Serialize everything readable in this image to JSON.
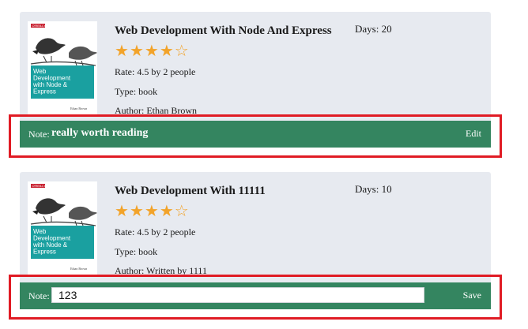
{
  "books": [
    {
      "cover": {
        "publisher": "O'REILLY",
        "title_lines": [
          "Web",
          "Development",
          "with Node &",
          "Express"
        ],
        "author": "Ethan Brown"
      },
      "title": "Web Development With Node And Express",
      "days": "Days: 20",
      "rating_stars": 4,
      "rating_max": 5,
      "rate": "Rate: 4.5 by 2 people",
      "type": "Type: book",
      "author": "Author: Ethan Brown",
      "note_label": "Note:",
      "note_text": "really worth reading",
      "action_label": "Edit"
    },
    {
      "cover": {
        "publisher": "O'REILLY",
        "title_lines": [
          "Web",
          "Development",
          "with Node &",
          "Express"
        ],
        "author": "Ethan Brown"
      },
      "title": "Web Development With 11111",
      "days": "Days: 10",
      "rating_stars": 4,
      "rating_max": 5,
      "rate": "Rate: 4.5 by 2 people",
      "type": "Type: book",
      "author": "Author: Written by 1111",
      "note_label": "Note:",
      "note_value": "123",
      "action_label": "Save"
    }
  ],
  "colors": {
    "card_bg": "#e7eaf0",
    "note_bar": "#348560",
    "star": "#f2a32a",
    "highlight": "#e01b24",
    "cover_teal": "#1aa0a0"
  }
}
